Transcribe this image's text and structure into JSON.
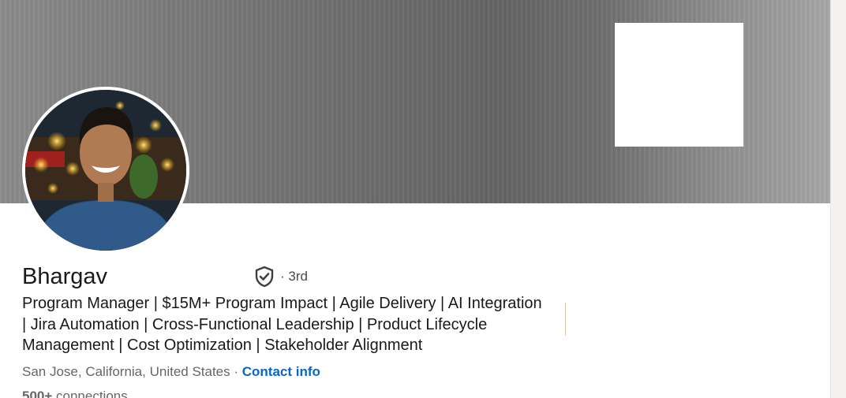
{
  "profile": {
    "name": "Bhargav",
    "degree": "· 3rd",
    "headline": "Program Manager | $15M+ Program Impact | Agile Delivery | AI Integration | Jira Automation | Cross-Functional Leadership | Product Lifecycle Management | Cost Optimization | Stakeholder Alignment",
    "location": "San Jose, California, United States",
    "separator": " · ",
    "contact_label": "Contact info",
    "connections_count": "500+",
    "connections_label": " connections"
  },
  "icons": {
    "verified": "verified-shield-icon",
    "avatar": "profile-photo"
  },
  "colors": {
    "link": "#0a66c2",
    "text": "#191919",
    "muted": "#666666"
  }
}
